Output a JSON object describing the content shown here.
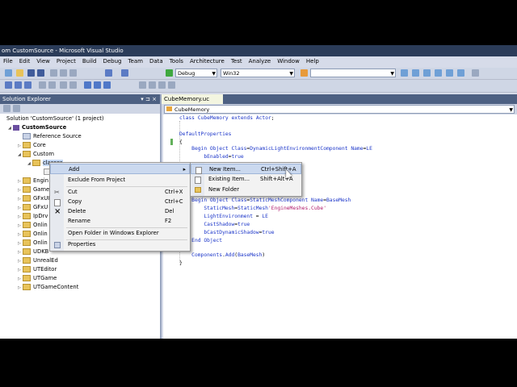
{
  "window": {
    "title": "om CustomSource - Microsoft Visual Studio"
  },
  "menu": [
    "File",
    "Edit",
    "View",
    "Project",
    "Build",
    "Debug",
    "Team",
    "Data",
    "Tools",
    "Architecture",
    "Test",
    "Analyze",
    "Window",
    "Help"
  ],
  "toolbar": {
    "config": "Debug",
    "platform": "Win32"
  },
  "solution_explorer": {
    "title": "Solution Explorer",
    "pin": "▾ ⊐ ×",
    "tree": [
      {
        "label": "Solution 'CustomSource' (1 project)",
        "kind": "solution"
      },
      {
        "label": "CustomSource",
        "kind": "project"
      },
      {
        "label": "Reference Source",
        "kind": "folder"
      },
      {
        "label": "Core",
        "kind": "folder"
      },
      {
        "label": "Custom",
        "kind": "folder"
      },
      {
        "label": "classes",
        "kind": "folder"
      },
      {
        "label": "Engin",
        "kind": "folder"
      },
      {
        "label": "Game",
        "kind": "folder"
      },
      {
        "label": "GFxUI",
        "kind": "folder"
      },
      {
        "label": "GFxU",
        "kind": "folder"
      },
      {
        "label": "IpDrv",
        "kind": "folder"
      },
      {
        "label": "Onlin",
        "kind": "folder"
      },
      {
        "label": "Onlin",
        "kind": "folder"
      },
      {
        "label": "Onlin",
        "kind": "folder"
      },
      {
        "label": "UDKB",
        "kind": "folder"
      },
      {
        "label": "UnrealEd",
        "kind": "folder"
      },
      {
        "label": "UTEditor",
        "kind": "folder"
      },
      {
        "label": "UTGame",
        "kind": "folder"
      },
      {
        "label": "UTGameContent",
        "kind": "folder"
      }
    ]
  },
  "editor": {
    "tab": "CubeMemory.uc",
    "nav": "CubeMemory",
    "lines": [
      "class CubeMemory extends Actor;",
      "",
      "DefaultProperties",
      "{",
      "    Begin Object Class=DynamicLightEnvironmentComponent Name=LE",
      "        bEnabled=true",
      "",
      "",
      "",
      "",
      "    Begin Object Class=StaticMeshComponent Name=BaseMesh",
      "        StaticMesh=StaticMesh'EngineMeshes.Cube'",
      "        LightEnvironment = LE",
      "        CastShadow=true",
      "        bCastDynamicShadow=true",
      "    End Object",
      "",
      "    Components.Add(BaseMesh)",
      "}"
    ]
  },
  "context_menu": {
    "items": [
      {
        "label": "Add",
        "shortcut": "▸"
      },
      {
        "label": "Exclude From Project",
        "shortcut": ""
      },
      {
        "label": "Cut",
        "shortcut": "Ctrl+X"
      },
      {
        "label": "Copy",
        "shortcut": "Ctrl+C"
      },
      {
        "label": "Delete",
        "shortcut": "Del"
      },
      {
        "label": "Rename",
        "shortcut": "F2"
      },
      {
        "label": "Open Folder in Windows Explorer",
        "shortcut": ""
      },
      {
        "label": "Properties",
        "shortcut": ""
      }
    ]
  },
  "add_submenu": {
    "items": [
      {
        "label": "New Item...",
        "shortcut": "Ctrl+Shift+A"
      },
      {
        "label": "Existing Item...",
        "shortcut": "Shift+Alt+A"
      },
      {
        "label": "New Folder",
        "shortcut": ""
      }
    ]
  }
}
